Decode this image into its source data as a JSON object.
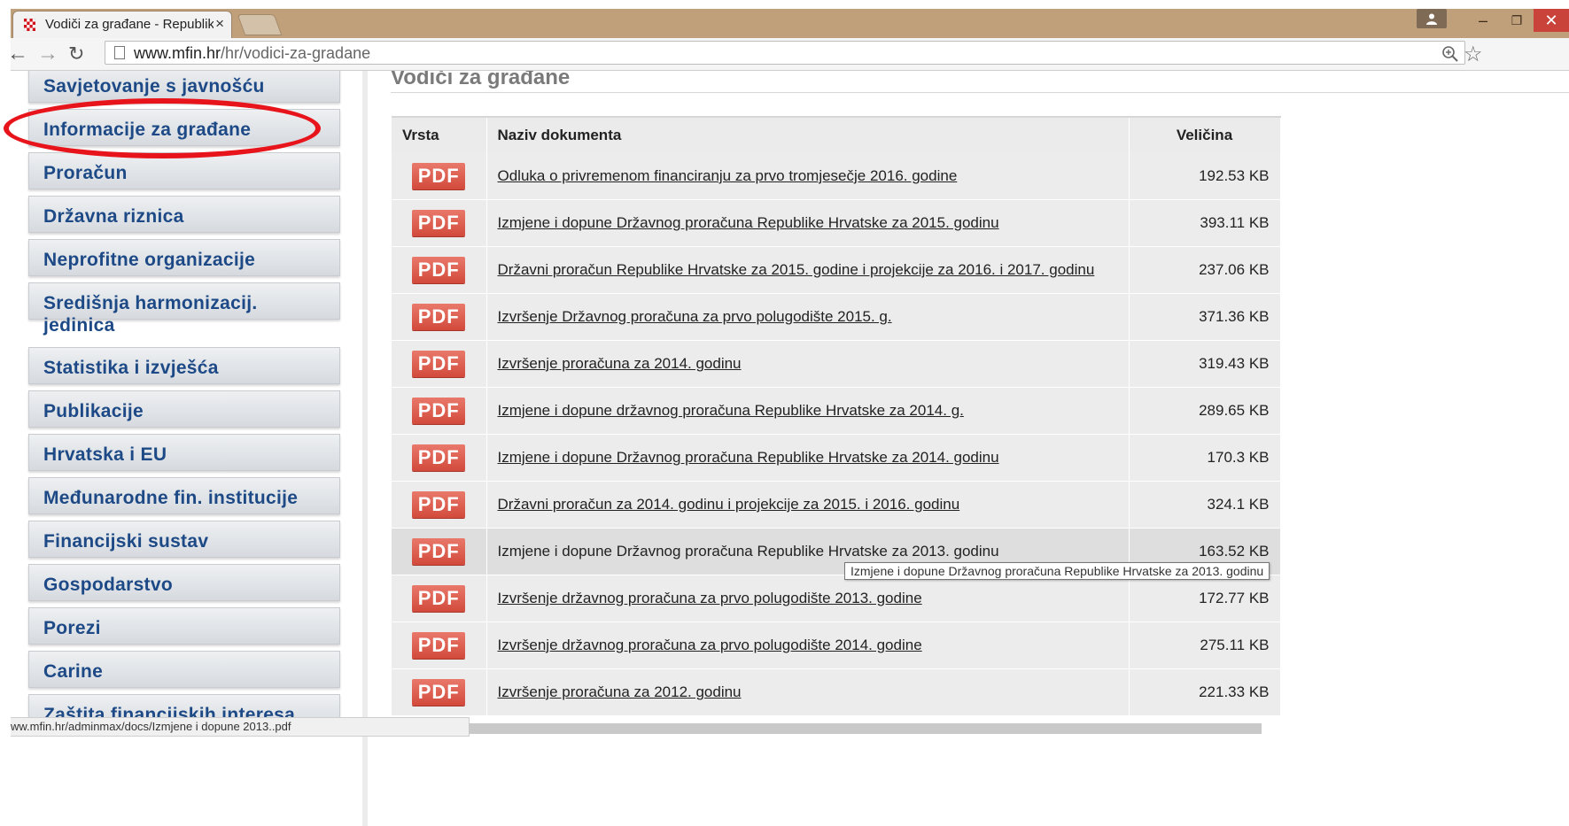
{
  "browser": {
    "tab_title": "Vodiči za građane - Republika Hrvatska",
    "tab_close": "×",
    "url_host": "www.mfin.hr",
    "url_path": "/hr/vodici-za-gradane",
    "icons": [
      "back-icon",
      "forward-icon",
      "reload-icon",
      "page-icon",
      "zoom-icon",
      "star-icon",
      "user-icon",
      "minimize-icon",
      "restore-icon",
      "close-icon"
    ],
    "close_color": "#c9433b",
    "frame_color": "#c0a07a"
  },
  "sidebar": {
    "items": [
      {
        "label": "Savjetovanje s javnošću"
      },
      {
        "label": "Informacije za građane"
      },
      {
        "label": "Proračun"
      },
      {
        "label": "Državna riznica"
      },
      {
        "label": "Neprofitne organizacije"
      },
      {
        "label": "Središnja harmonizacij. jedinica"
      },
      {
        "label": "Statistika i izvješća"
      },
      {
        "label": "Publikacije"
      },
      {
        "label": "Hrvatska i EU"
      },
      {
        "label": "Međunarodne fin. institucije"
      },
      {
        "label": "Financijski sustav"
      },
      {
        "label": "Gospodarstvo"
      },
      {
        "label": "Porezi"
      },
      {
        "label": "Carine"
      },
      {
        "label": "Zaštita financijskih interesa"
      }
    ],
    "link_color": "#1d4a86",
    "highlight_color": "#e8141b"
  },
  "main": {
    "heading": "Vodiči za građane",
    "table": {
      "headers": {
        "type": "Vrsta",
        "name": "Naziv dokumenta",
        "size": "Veličina"
      },
      "badge": "PDF",
      "rows": [
        {
          "name": "Odluka o privremenom financiranju za prvo tromjesečje 2016. godine",
          "size": "192.53 KB"
        },
        {
          "name": "Izmjene i dopune Državnog proračuna Republike Hrvatske za 2015. godinu",
          "size": "393.11 KB"
        },
        {
          "name": "Državni proračun Republike Hrvatske za 2015. godine i projekcije za 2016. i 2017. godinu",
          "size": "237.06 KB"
        },
        {
          "name": "Izvršenje Državnog proračuna za prvo polugodište 2015. g.",
          "size": "371.36 KB"
        },
        {
          "name": "Izvršenje proračuna za 2014. godinu",
          "size": "319.43 KB"
        },
        {
          "name": "Izmjene i dopune državnog proračuna Republike Hrvatske za 2014. g.",
          "size": "289.65 KB"
        },
        {
          "name": "Izmjene i dopune Državnog proračuna Republike Hrvatske za 2014. godinu",
          "size": "170.3 KB"
        },
        {
          "name": "Državni proračun za 2014. godinu i projekcije za 2015. i 2016. godinu",
          "size": "324.1 KB"
        },
        {
          "name": "Izmjene i dopune Državnog proračuna Republike Hrvatske za 2013. godinu",
          "size": "163.52 KB",
          "hovered": true
        },
        {
          "name": "Izvršenje državnog proračuna za prvo polugodište 2013. godine",
          "size": "172.77 KB"
        },
        {
          "name": "Izvršenje državnog proračuna za prvo polugodište 2014. godine",
          "size": "275.11 KB"
        },
        {
          "name": "Izvršenje proračuna za 2012. godinu",
          "size": "221.33 KB"
        }
      ]
    },
    "tooltip": "Izmjene i dopune Državnog proračuna Republike Hrvatske za 2013. godinu"
  },
  "status_bar": {
    "url": "ww.mfin.hr/adminmax/docs/Izmjene i dopune 2013..pdf"
  }
}
